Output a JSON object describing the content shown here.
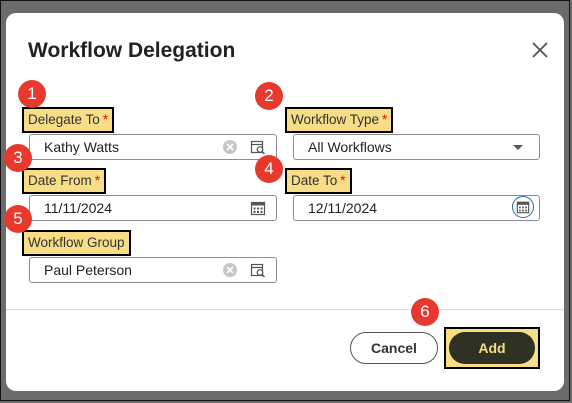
{
  "dialog": {
    "title": "Workflow Delegation",
    "close_icon": "close-icon",
    "fields": {
      "delegate_to": {
        "label": "Delegate To",
        "required_mark": "*",
        "value": "Kathy Watts"
      },
      "workflow_type": {
        "label": "Workflow Type",
        "required_mark": "*",
        "value": "All Workflows"
      },
      "date_from": {
        "label": "Date From",
        "required_mark": "*",
        "value": "11/11/2024"
      },
      "date_to": {
        "label": "Date To",
        "required_mark": "*",
        "value": "12/11/2024"
      },
      "workflow_group": {
        "label": "Workflow Group",
        "value": "Paul Peterson"
      }
    },
    "buttons": {
      "cancel": "Cancel",
      "add": "Add"
    }
  },
  "callouts": [
    "1",
    "2",
    "3",
    "4",
    "5",
    "6"
  ],
  "colors": {
    "highlight": "#f6dd86",
    "badge": "#e8392f",
    "required": "#dd1111",
    "add_button": "#2f3124",
    "calendar_focus": "#1f6f9c"
  },
  "icons": [
    "clear-icon",
    "lookup-icon",
    "calendar-icon",
    "dropdown-arrow-icon"
  ]
}
